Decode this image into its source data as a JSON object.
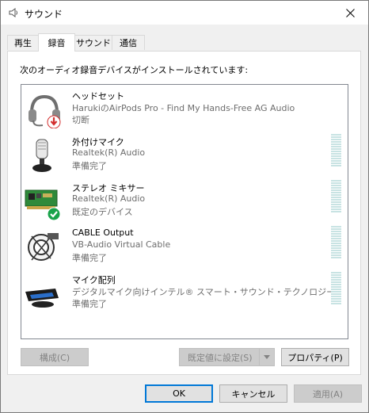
{
  "window": {
    "title": "サウンド"
  },
  "tabs": [
    {
      "label": "再生",
      "active": false
    },
    {
      "label": "録音",
      "active": true
    },
    {
      "label": "サウンド",
      "active": false
    },
    {
      "label": "通信",
      "active": false
    }
  ],
  "instructions": "次のオーディオ録音デバイスがインストールされています:",
  "devices": [
    {
      "name": "ヘッドセット",
      "description": "HarukiのAirPods Pro - Find My Hands-Free AG Audio",
      "status": "切断",
      "icon": "headset-icon",
      "badge": "disconnected-badge-icon",
      "meter": false
    },
    {
      "name": "外付けマイク",
      "description": "Realtek(R) Audio",
      "status": "準備完了",
      "icon": "external-microphone-icon",
      "badge": "",
      "meter": true
    },
    {
      "name": "ステレオ ミキサー",
      "description": "Realtek(R) Audio",
      "status": "既定のデバイス",
      "icon": "sound-card-icon",
      "badge": "default-check-badge-icon",
      "meter": true
    },
    {
      "name": "CABLE Output",
      "description": "VB-Audio Virtual Cable",
      "status": "準備完了",
      "icon": "cable-icon",
      "badge": "",
      "meter": true
    },
    {
      "name": "マイク配列",
      "description": "デジタルマイク向けインテル® スマート・サウンド・テクノロジー",
      "status": "準備完了",
      "icon": "microphone-array-icon",
      "badge": "",
      "meter": true
    }
  ],
  "buttons": {
    "configure": "構成(C)",
    "set_default": "既定値に設定(S)",
    "properties": "プロパティ(P)",
    "ok": "OK",
    "cancel": "キャンセル",
    "apply": "適用(A)"
  },
  "colors": {
    "accent": "#0078d7",
    "check": "#1aa34a",
    "disconnected": "#d32f2f",
    "meter": "#c8e3e3"
  }
}
